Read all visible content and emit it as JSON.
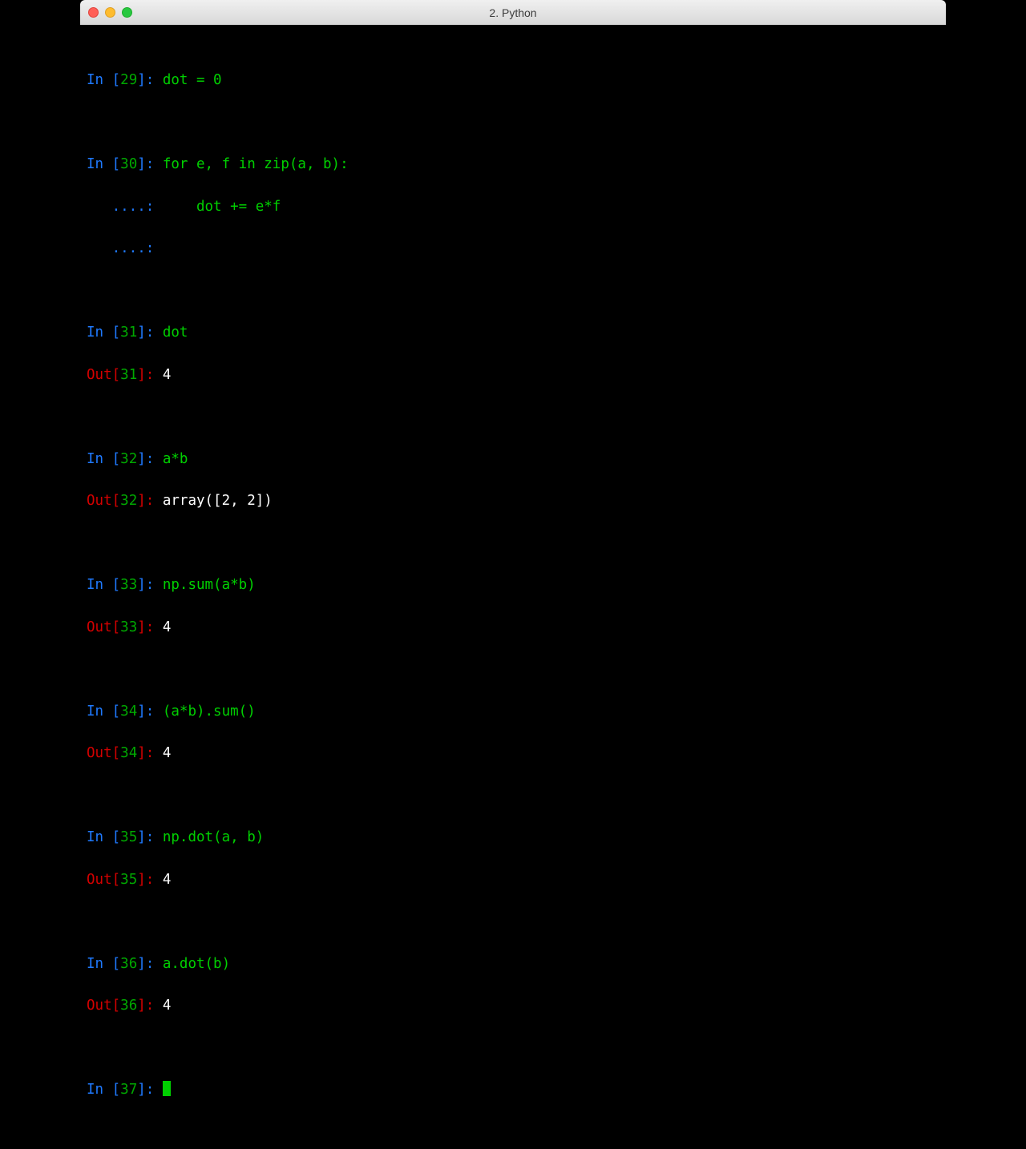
{
  "window": {
    "title": "2. Python"
  },
  "prompt": {
    "in": "In ",
    "out": "Out",
    "cont": "   ....: "
  },
  "cells": {
    "p29": {
      "n": "29",
      "code": "dot = 0"
    },
    "p30": {
      "n": "30",
      "code1": "for e, f in zip(a, b):",
      "code2": "    dot += e*f"
    },
    "p31": {
      "n": "31",
      "code": "dot",
      "out": "4"
    },
    "p32": {
      "n": "32",
      "code": "a*b",
      "out": "array([2, 2])"
    },
    "p33": {
      "n": "33",
      "code": "np.sum(a*b)",
      "out": "4"
    },
    "p34": {
      "n": "34",
      "code": "(a*b).sum()",
      "out": "4"
    },
    "p35": {
      "n": "35",
      "code": "np.dot(a, b)",
      "out": "4"
    },
    "p36": {
      "n": "36",
      "code": "a.dot(b)",
      "out": "4"
    },
    "p37": {
      "n": "37"
    }
  }
}
